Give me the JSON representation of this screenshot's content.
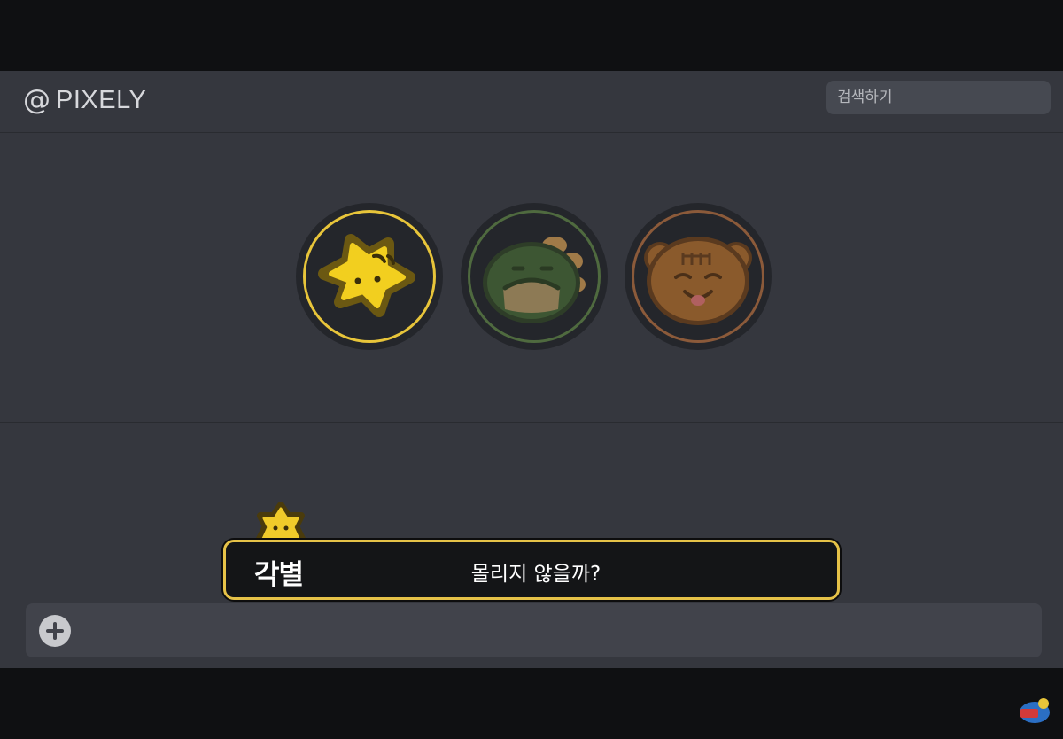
{
  "app": {
    "logo_symbol": "@",
    "logo_name": "PIXELY"
  },
  "search": {
    "placeholder": "검색하기"
  },
  "avatars": [
    {
      "icon": "star-character-icon",
      "ring_color": "#e8c53a"
    },
    {
      "icon": "dinosaur-character-icon",
      "ring_color": "#4f6a3f"
    },
    {
      "icon": "bear-character-icon",
      "ring_color": "#8b5a3a"
    }
  ],
  "composer": {
    "add_icon": "plus-icon"
  },
  "subtitle": {
    "speaker": "각별",
    "text": "몰리지 않을까?",
    "border_color": "#e6c248"
  },
  "colors": {
    "background": "#35373e",
    "letterbox": "#0f1012",
    "search_bg": "#464951",
    "composer_bg": "#41434b"
  }
}
